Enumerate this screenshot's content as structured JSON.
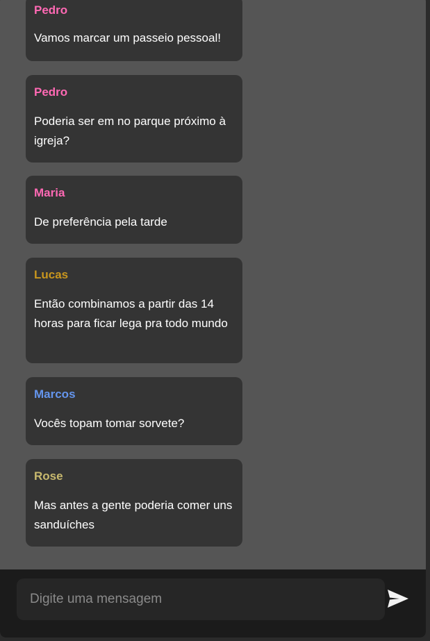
{
  "messages": [
    {
      "author": "Pedro",
      "text": "Vamos marcar um passeio pessoal!",
      "author_color": "#ff69b4"
    },
    {
      "author": "Pedro",
      "text": "Poderia ser em no parque próximo à igreja?",
      "author_color": "#ff69b4"
    },
    {
      "author": "Maria",
      "text": "De preferência pela tarde",
      "author_color": "#ff69b4"
    },
    {
      "author": "Lucas",
      "text": "Então combinamos a partir das 14 horas para ficar lega pra todo mundo",
      "author_color": "#c8961e"
    },
    {
      "author": "Marcos",
      "text": "Vocês topam tomar sorvete?",
      "author_color": "#6495ed"
    },
    {
      "author": "Rose",
      "text": "Mas antes a gente poderia comer uns sanduíches",
      "author_color": "#c8b96e"
    }
  ],
  "composer": {
    "placeholder": "Digite uma mensagem",
    "value": "",
    "send_icon": "send-icon"
  },
  "colors": {
    "chat_background": "#555555",
    "bubble_background": "#343434",
    "composer_background": "#1b1b1b",
    "input_background": "#262626",
    "message_text": "#ffffff"
  }
}
